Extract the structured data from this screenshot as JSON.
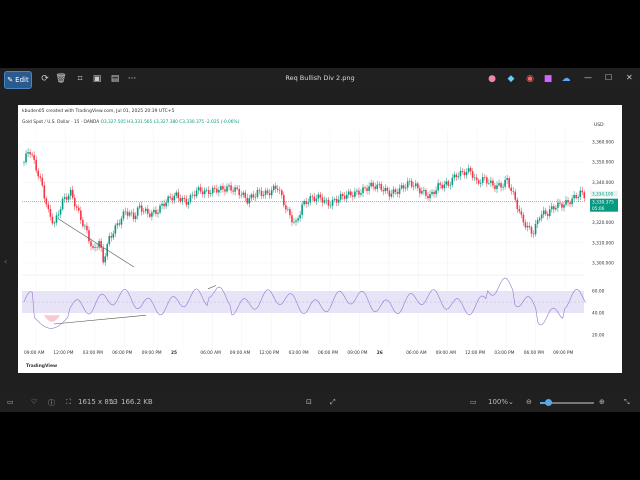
{
  "window": {
    "title": "Req Bullish Div 2.png",
    "edit_label": "Edit",
    "controls": {
      "minimize": "—",
      "maximize": "☐",
      "close": "✕"
    }
  },
  "toolbar_icons": [
    "edit-icon",
    "rotate-icon",
    "delete-icon",
    "crop-icon",
    "save-icon",
    "more-icon"
  ],
  "right_icons": [
    "color-app-icon",
    "paint-icon",
    "clipchamp-icon",
    "photos-icon",
    "onedrive-icon",
    "share-icon"
  ],
  "image": {
    "header_line1": "kbuden05 created with TradingView.com, Jul 01, 2025 20:39 UTC+5",
    "header_symbol": "Gold Spot / U.S. Dollar · 15 · OANDA",
    "header_ohlc": "O3,327.505 H3,331.565 L3,327.380 C3,330.375 -2.025 (-0.06%)",
    "price_axis": {
      "unit": "USD",
      "ticks": [
        "3,360.000",
        "3,350.000",
        "3,340.000",
        "3,330.000",
        "3,320.000",
        "3,310.000",
        "3,300.000"
      ],
      "last_price_top": "3,334.100",
      "last_price": "3,330.375",
      "countdown": "05:06"
    },
    "rsi_axis": {
      "ticks": [
        "60.00",
        "40.00",
        "20.00"
      ]
    },
    "time_axis": [
      "09:00 AM",
      "12:00 PM",
      "03:00 PM",
      "06:00 PM",
      "09:00 PM",
      "25",
      "06:00 AM",
      "09:00 AM",
      "12:00 PM",
      "03:00 PM",
      "06:00 PM",
      "09:00 PM",
      "26",
      "06:00 AM",
      "09:00 AM",
      "12:00 PM",
      "03:00 PM",
      "06:00 PM",
      "09:00 PM"
    ],
    "watermark": "TradingView",
    "colors": {
      "up": "#089981",
      "down": "#f23645",
      "rsi_band": "#e8e4f8",
      "rsi_line": "#9575cd"
    }
  },
  "status": {
    "dimensions": "1615 x 853",
    "filesize": "166.2 KB",
    "zoom": "100%"
  },
  "chart_data": {
    "type": "candlestick",
    "price_axis_ticks": [
      3360,
      3350,
      3340,
      3330,
      3320,
      3310,
      3300
    ],
    "rsi_levels": [
      60,
      40,
      20
    ]
  }
}
